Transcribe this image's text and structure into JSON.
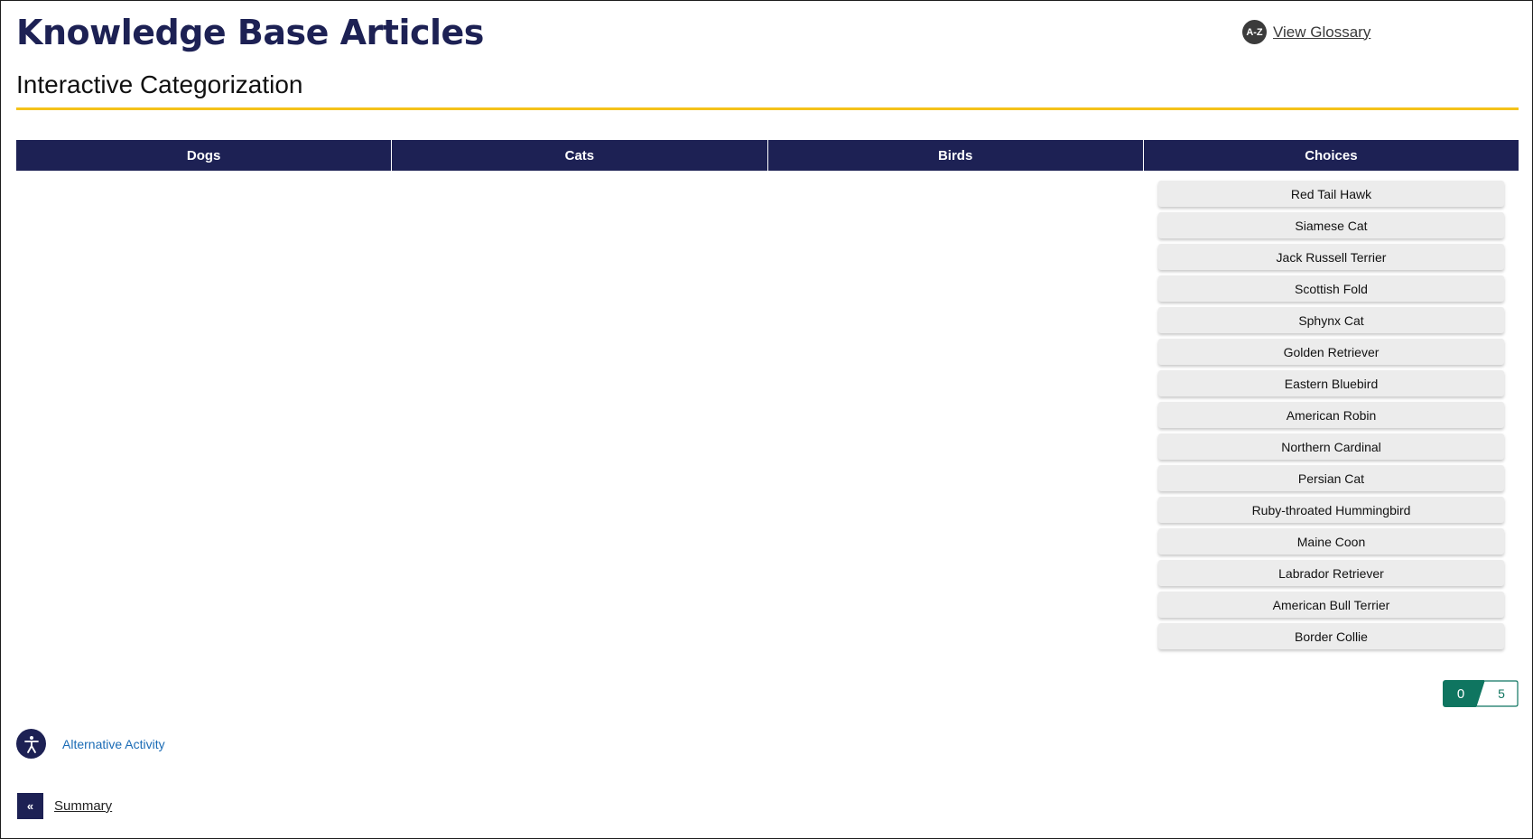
{
  "header": {
    "title": "Knowledge Base Articles",
    "glossary_icon_text": "A-Z",
    "glossary_label": "View Glossary"
  },
  "activity": {
    "subtitle": "Interactive Categorization",
    "accent_color": "#f4c21a",
    "header_color": "#1d2154"
  },
  "columns": [
    {
      "label": "Dogs"
    },
    {
      "label": "Cats"
    },
    {
      "label": "Birds"
    },
    {
      "label": "Choices"
    }
  ],
  "choices": [
    "Red Tail Hawk",
    "Siamese Cat",
    "Jack Russell Terrier",
    "Scottish Fold",
    "Sphynx Cat",
    "Golden Retriever",
    "Eastern Bluebird",
    "American Robin",
    "Northern Cardinal",
    "Persian Cat",
    "Ruby-throated Hummingbird",
    "Maine Coon",
    "Labrador Retriever",
    "American Bull Terrier",
    "Border Collie"
  ],
  "score": {
    "current": "0",
    "total": "5",
    "color": "#0f7560"
  },
  "footer": {
    "alt_activity_icon": "accessibility-icon",
    "alt_activity_label": "Alternative Activity",
    "nav_icon_text": "«",
    "nav_label": "Summary"
  }
}
